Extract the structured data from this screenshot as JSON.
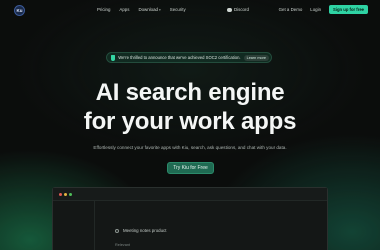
{
  "nav": {
    "logo_text": "Ku",
    "links": [
      "Pricing",
      "Apps",
      "Download",
      "Security"
    ],
    "discord": "Discord",
    "get_demo": "Get a Demo",
    "login": "Login",
    "signup": "Sign up for free"
  },
  "announcement": {
    "text": "We're thrilled to announce that we've achieved SOC2 certification.",
    "button": "Learn more"
  },
  "hero": {
    "line1": "AI search engine",
    "line2": "for your work apps",
    "subtitle": "Effortlessly connect your favorite apps with Kiu, search, ask questions, and chat with your data.",
    "cta": "Try Kiu for Free"
  },
  "app_preview": {
    "search_text": "Meeting notes product",
    "result_label": "Relevant"
  },
  "colors": {
    "accent": "#2fd3a4",
    "background": "#0b0d0c",
    "cta_bg": "#1f6a52"
  }
}
